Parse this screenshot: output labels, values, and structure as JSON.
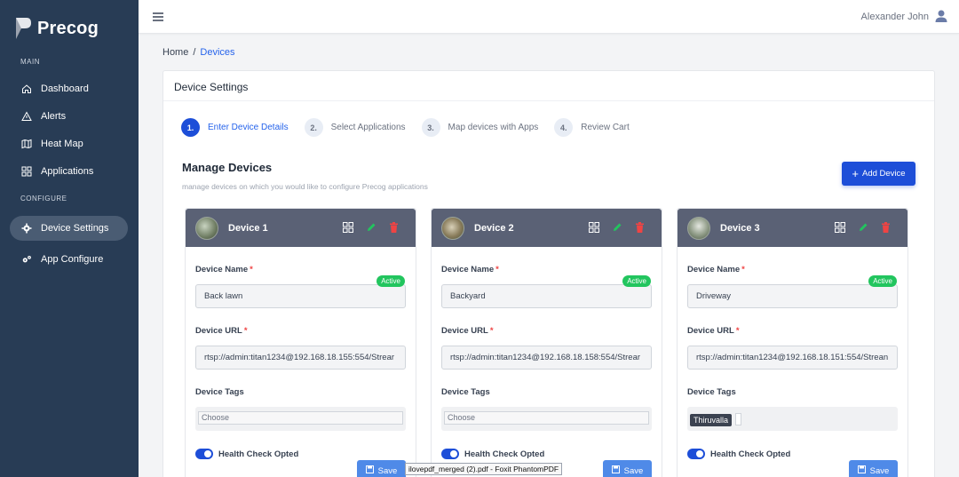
{
  "app": {
    "name": "Precog"
  },
  "sidebar": {
    "sections": {
      "main": "MAIN",
      "configure": "CONFIGURE"
    },
    "items": [
      {
        "label": "Dashboard",
        "icon": "home-icon"
      },
      {
        "label": "Alerts",
        "icon": "warning-icon"
      },
      {
        "label": "Heat Map",
        "icon": "map-icon"
      },
      {
        "label": "Applications",
        "icon": "grid-icon"
      },
      {
        "label": "Device Settings",
        "icon": "gear-icon",
        "active": true
      },
      {
        "label": "App Configure",
        "icon": "gears-icon"
      }
    ]
  },
  "topbar": {
    "user_name": "Alexander John"
  },
  "breadcrumb": {
    "home": "Home",
    "separator": "/",
    "current": "Devices"
  },
  "panel": {
    "title": "Device Settings",
    "steps": [
      {
        "num": "1.",
        "label": "Enter Device Details",
        "active": true
      },
      {
        "num": "2.",
        "label": "Select Applications"
      },
      {
        "num": "3.",
        "label": "Map devices with Apps"
      },
      {
        "num": "4.",
        "label": "Review Cart"
      }
    ],
    "manage_title": "Manage Devices",
    "manage_subtitle": "manage devices on which you would like to configure Precog applications",
    "add_device_label": "Add Device"
  },
  "labels": {
    "device_name": "Device Name",
    "device_url": "Device URL",
    "device_tags": "Device Tags",
    "required_mark": "*",
    "health_check": "Health Check Opted",
    "save": "Save",
    "status": "Active",
    "choose": "Choose"
  },
  "devices": [
    {
      "title": "Device 1",
      "name": "Back lawn",
      "url": "rtsp://admin:titan1234@192.168.18.155:554/Strear",
      "tags": []
    },
    {
      "title": "Device 2",
      "name": "Backyard",
      "url": "rtsp://admin:titan1234@192.168.18.158:554/Strear",
      "tags": []
    },
    {
      "title": "Device 3",
      "name": "Driveway",
      "url": "rtsp://admin:titan1234@192.168.18.151:554/Strean",
      "tags": [
        "Thiruvalla"
      ]
    }
  ],
  "tooltip": {
    "text": "ilovepdf_merged (2).pdf - Foxit PhantomPDF"
  },
  "colors": {
    "sidebar": "#283c55",
    "accent": "#1d4ed8",
    "active_badge": "#22c55e",
    "edit": "#22c55e",
    "delete": "#ef4444",
    "card_header": "#5a6175"
  }
}
